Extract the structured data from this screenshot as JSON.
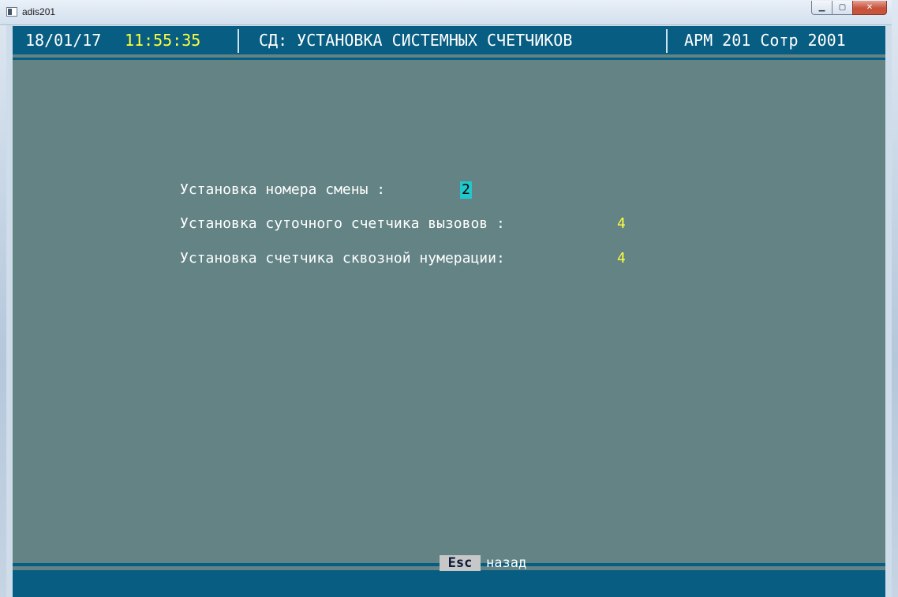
{
  "window": {
    "title": "adis201",
    "minimize_glyph": "▁",
    "maximize_glyph": "▢",
    "close_glyph": "✕"
  },
  "header": {
    "date": "18/01/17",
    "time": "11:55:35",
    "screen_title": "СД: УСТАНОВКА СИСТЕМНЫХ СЧЕТЧИКОВ",
    "workstation": "АРМ 201 Сотр 2001"
  },
  "form": {
    "shift_label": "Установка номера смены :",
    "shift_value": "2",
    "daily_counter_label": "Установка суточного счетчика вызовов :",
    "daily_counter_value": "4",
    "through_counter_label": "Установка счетчика сквозной нумерации:",
    "through_counter_value": "4"
  },
  "footer": {
    "esc_key": "Esc",
    "esc_label": "назад"
  },
  "colors": {
    "background": "#638385",
    "bar": "#085d82",
    "highlight_yellow": "#ffff3c",
    "cursor_cyan": "#22c7cb"
  }
}
